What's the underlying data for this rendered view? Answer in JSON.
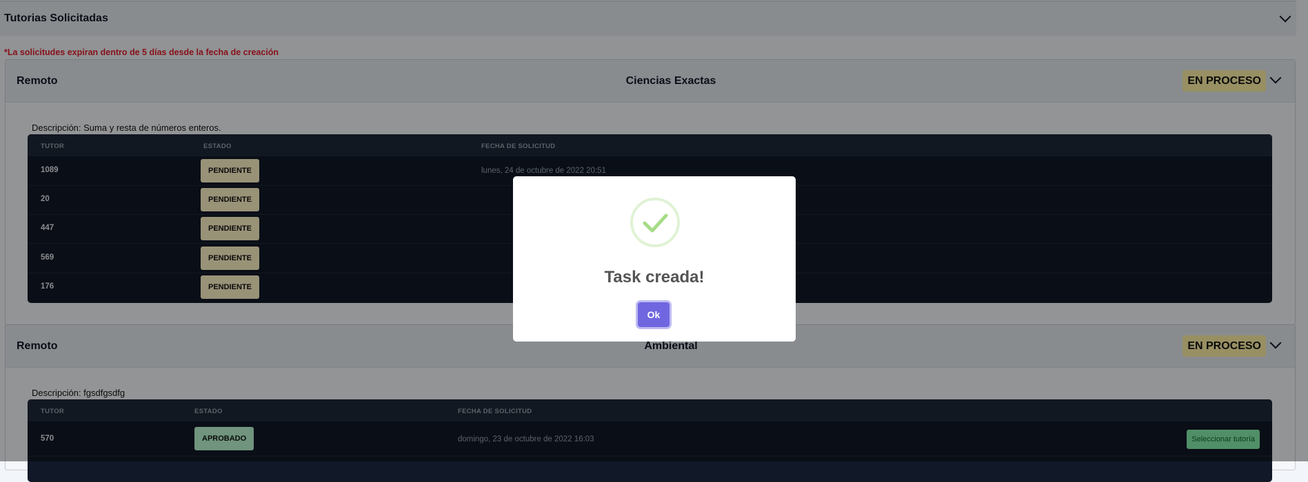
{
  "header": {
    "title": "Tutorias Solicitadas"
  },
  "warning": "*La solicitudes expiran dentro de 5 días desde la fecha de creación",
  "cards": [
    {
      "mode": "Remoto",
      "area": "Ciencias Exactas",
      "status": "EN PROCESO",
      "description": "Descripción: Suma y resta de números enteros.",
      "columns": {
        "tutor": "TUTOR",
        "estado": "ESTADO",
        "fecha": "FECHA DE SOLICITUD"
      },
      "rows": [
        {
          "tutor": "1089",
          "estado": "PENDIENTE",
          "fecha": "lunes, 24 de octubre de 2022 20:51"
        },
        {
          "tutor": "20",
          "estado": "PENDIENTE",
          "fecha": ""
        },
        {
          "tutor": "447",
          "estado": "PENDIENTE",
          "fecha": ""
        },
        {
          "tutor": "569",
          "estado": "PENDIENTE",
          "fecha": ""
        },
        {
          "tutor": "176",
          "estado": "PENDIENTE",
          "fecha": ""
        }
      ]
    },
    {
      "mode": "Remoto",
      "area": "Ambiental",
      "status": "EN PROCESO",
      "description": "Descripción: fgsdfgsdfg",
      "columns": {
        "tutor": "TUTOR",
        "estado": "ESTADO",
        "fecha": "FECHA DE SOLICITUD"
      },
      "rows": [
        {
          "tutor": "570",
          "estado": "APROBADO",
          "fecha": "domingo, 23 de octubre de 2022 16:03",
          "action": "Seleccionar tutoría"
        }
      ]
    }
  ],
  "modal": {
    "title": "Task creada!",
    "ok_label": "Ok",
    "icon": "check-circle-icon"
  },
  "colors": {
    "accent": "#7066e0",
    "warning": "#e11d2e",
    "success": "#a5dc86"
  }
}
